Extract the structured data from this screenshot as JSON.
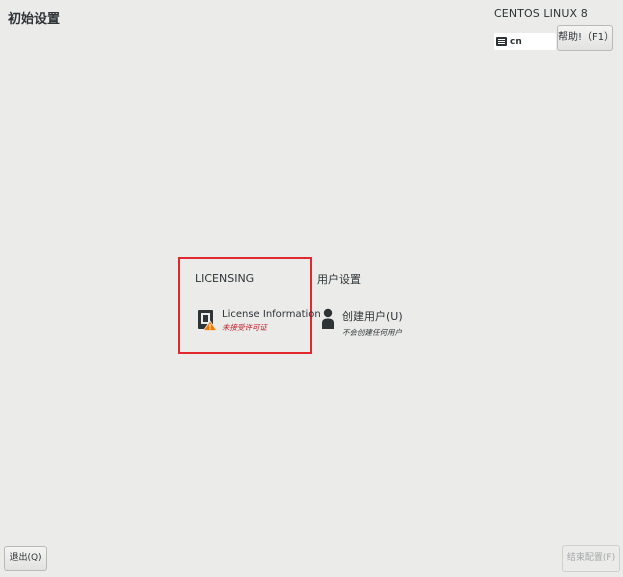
{
  "header": {
    "title": "初始设置",
    "product": "CENTOS LINUX 8",
    "keyboard_layout": "cn",
    "help_label": "帮助!（F1）"
  },
  "sections": {
    "licensing": {
      "header": "LICENSING",
      "spoke": {
        "title": "License Information",
        "status": "未接受许可证",
        "icon": "license-warning-icon"
      }
    },
    "user_settings": {
      "header": "用户设置",
      "spoke": {
        "title": "创建用户(U)",
        "status": "不会创建任何用户",
        "icon": "user-icon"
      }
    }
  },
  "footer": {
    "quit_label": "退出(Q)",
    "finish_label": "结束配置(F)"
  },
  "colors": {
    "background": "#ebebea",
    "highlight_border": "#e0282e",
    "warning_text": "#c01c28",
    "warning_triangle": "#f57900"
  }
}
